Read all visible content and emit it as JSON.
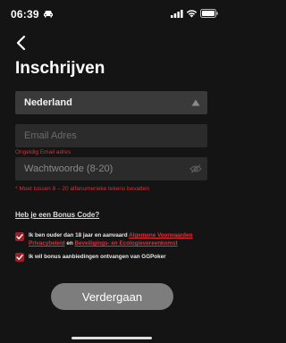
{
  "status_bar": {
    "time": "06:39"
  },
  "header": {
    "title": "Inschrijven"
  },
  "form": {
    "country": "Nederland",
    "email": {
      "placeholder": "Email Adres",
      "error": "Ongeldig Email adres"
    },
    "password": {
      "placeholder": "Wachtwoorde (8-20)",
      "error": "* Moet tussen 8 – 20 alfanumerieke tekens bevatten"
    },
    "bonus_code_link": "Heb je een Bonus Code?",
    "consent_age": {
      "text_a": "Ik ben ouder dan 18 jaar en aanvaard ",
      "link_terms": "Algemene Voorwaarden",
      "link_privacy": "Privacybeleid",
      "text_b": " en ",
      "link_security": "Beveiligings- en Ecologievereenkomst"
    },
    "consent_offers": "Ik wil bonus aanbiedingen ontvangen van GGPoker",
    "submit_label": "Verdergaan"
  },
  "colors": {
    "background": "#141414",
    "error": "#d0333a",
    "checkbox": "#9b1f26",
    "button": "#7d7d7d"
  }
}
